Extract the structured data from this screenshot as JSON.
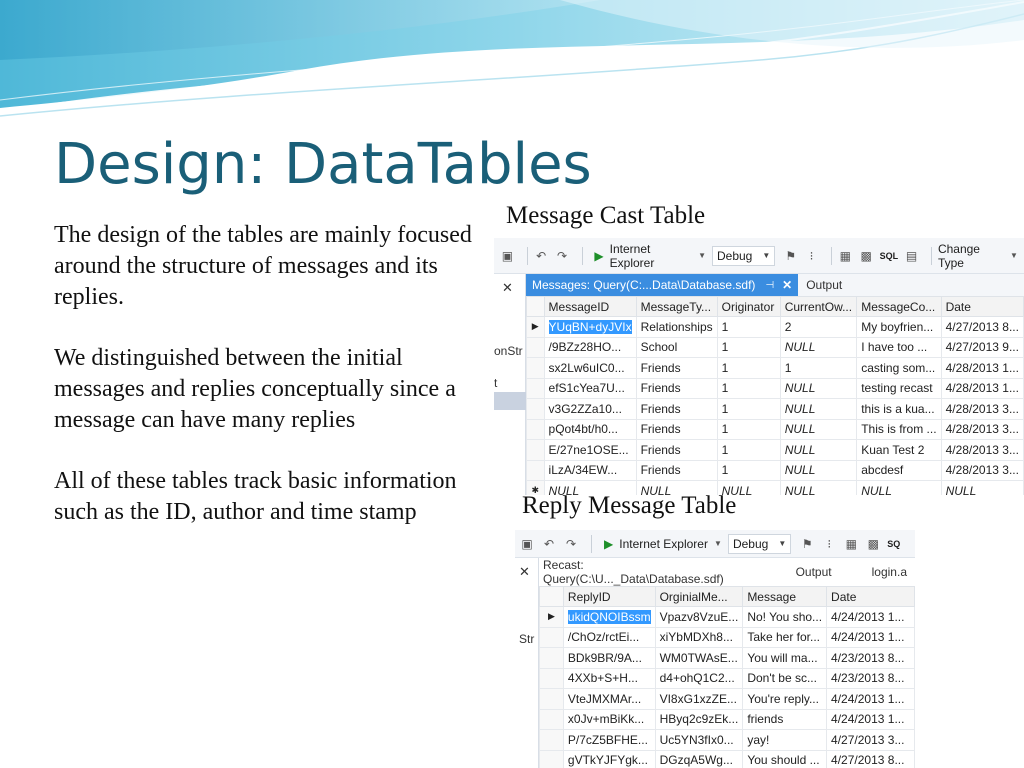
{
  "slide": {
    "title": "Design: DataTables",
    "paragraphs": [
      "The design of the tables are mainly focused around the structure of messages and its replies.",
      "We distinguished between the initial messages and replies conceptually since a message can have many replies",
      "All of these tables track basic information such as the ID, author and time stamp"
    ],
    "caption1": "Message Cast Table",
    "caption2": "Reply Message Table"
  },
  "shot1": {
    "toolbar": {
      "browser": "Internet Explorer",
      "config": "Debug",
      "change_type": "Change Type",
      "sql": "SQL"
    },
    "left_pane": {
      "text1": "onStr",
      "text2": "t",
      "close": "✕"
    },
    "tabs": {
      "active": "Messages: Query(C:...Data\\Database.sdf)",
      "pin": "⊣",
      "close": "✕",
      "other": "Output"
    },
    "columns": [
      "MessageID",
      "MessageTy...",
      "Originator",
      "CurrentOw...",
      "MessageCo...",
      "Date"
    ],
    "rows": [
      [
        "YUqBN+dyJVIx",
        "Relationships",
        "1",
        "2",
        "My boyfrien...",
        "4/27/2013 8..."
      ],
      [
        "/9BZz28HO...",
        "School",
        "1",
        "NULL",
        "I have too ...",
        "4/27/2013 9..."
      ],
      [
        "sx2Lw6uIC0...",
        "Friends",
        "1",
        "1",
        "casting som...",
        "4/28/2013 1..."
      ],
      [
        "efS1cYea7U...",
        "Friends",
        "1",
        "NULL",
        "testing recast",
        "4/28/2013 1..."
      ],
      [
        "v3G2ZZa10...",
        "Friends",
        "1",
        "NULL",
        "this is a kua...",
        "4/28/2013 3..."
      ],
      [
        "pQot4bt/h0...",
        "Friends",
        "1",
        "NULL",
        "This is from ...",
        "4/28/2013 3..."
      ],
      [
        "E/27ne1OSE...",
        "Friends",
        "1",
        "NULL",
        "Kuan Test 2",
        "4/28/2013 3..."
      ],
      [
        "iLzA/34EW...",
        "Friends",
        "1",
        "NULL",
        "abcdesf",
        "4/28/2013 3..."
      ],
      [
        "NULL",
        "NULL",
        "NULL",
        "NULL",
        "NULL",
        "NULL"
      ]
    ],
    "row_markers": [
      "▶",
      "",
      "",
      "",
      "",
      "",
      "",
      "",
      "✱"
    ]
  },
  "shot2": {
    "toolbar": {
      "browser": "Internet Explorer",
      "config": "Debug",
      "sql": "SQ"
    },
    "left_pane": {
      "text1": "Str",
      "close": "✕"
    },
    "tabs": {
      "active": "Recast: Query(C:\\U..._Data\\Database.sdf)",
      "output": "Output",
      "other": "login.a"
    },
    "columns": [
      "ReplyID",
      "OrginialMe...",
      "Message",
      "Date"
    ],
    "rows": [
      [
        "ukidQNOIBssm",
        "Vpazv8VzuE...",
        "No! You sho...",
        "4/24/2013 1..."
      ],
      [
        "/ChOz/rctEi...",
        "xiYbMDXh8...",
        "Take her for...",
        "4/24/2013 1..."
      ],
      [
        "BDk9BR/9A...",
        "WM0TWAsE...",
        "You will ma...",
        "4/23/2013 8..."
      ],
      [
        "4XXb+S+H...",
        "d4+ohQ1C2...",
        "Don't be sc...",
        "4/23/2013 8..."
      ],
      [
        "VteJMXMAr...",
        "VI8xG1xzZE...",
        "You're reply...",
        "4/24/2013 1..."
      ],
      [
        "x0Jv+mBiKk...",
        "HByq2c9zEk...",
        "friends",
        "4/24/2013 1..."
      ],
      [
        "P/7cZ5BFHE...",
        "Uc5YN3fIx0...",
        "yay!",
        "4/27/2013 3..."
      ],
      [
        "gVTkYJFYgk...",
        "DGzqA5Wg...",
        "You should ...",
        "4/27/2013 8..."
      ]
    ],
    "row_markers": [
      "▶",
      "",
      "",
      "",
      "",
      "",
      "",
      ""
    ]
  },
  "colors": {
    "title": "#1a5f78",
    "tab_active": "#3a8de0",
    "selection": "#3399ff"
  }
}
